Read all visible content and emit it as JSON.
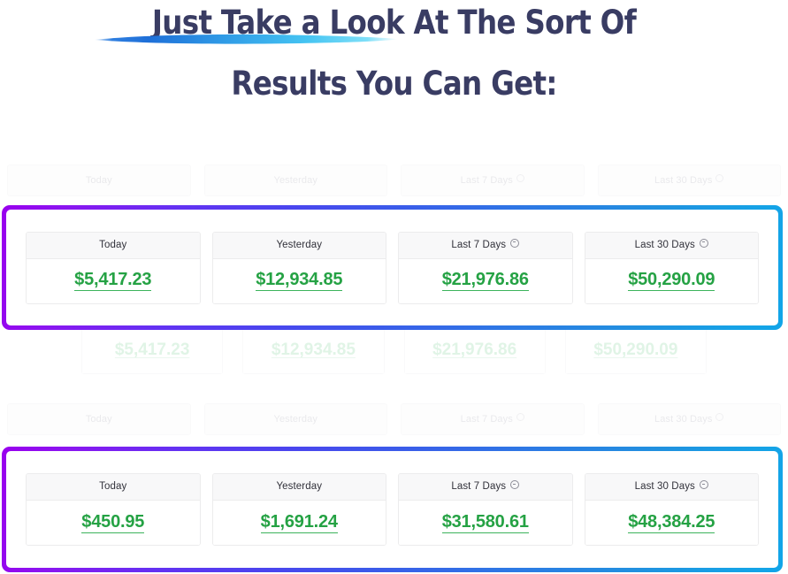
{
  "headline": {
    "line1": "Just Take a Look At The Sort Of",
    "line2": "Results You Can Get:",
    "color": "#393c63",
    "swoosh_color_start": "#1c5fd0",
    "swoosh_color_end": "#49d2f5"
  },
  "theme": {
    "accent_gradient_start": "#9900ee",
    "accent_gradient_mid": "#3a5ce9",
    "accent_gradient_end": "#12a5e8",
    "value_green": "#25a244",
    "card_header_bg": "#f8f8f9",
    "card_border": "#ececed",
    "page_bg": "#ffffff"
  },
  "panels": [
    {
      "name": "earnings-panel-1",
      "cards": [
        {
          "label": "Today",
          "has_info_icon": false,
          "value": "$5,417.23"
        },
        {
          "label": "Yesterday",
          "has_info_icon": false,
          "value": "$12,934.85"
        },
        {
          "label": "Last 7 Days",
          "has_info_icon": true,
          "value": "$21,976.86"
        },
        {
          "label": "Last 30 Days",
          "has_info_icon": true,
          "value": "$50,290.09"
        }
      ]
    },
    {
      "name": "earnings-panel-2",
      "cards": [
        {
          "label": "Today",
          "has_info_icon": false,
          "value": "$450.95"
        },
        {
          "label": "Yesterday",
          "has_info_icon": false,
          "value": "$1,691.24"
        },
        {
          "label": "Last 7 Days",
          "has_info_icon": true,
          "value": "$31,580.61"
        },
        {
          "label": "Last 30 Days",
          "has_info_icon": true,
          "value": "$48,384.25"
        }
      ]
    }
  ],
  "background_ghost": {
    "top_header_row": [
      {
        "label": "Today",
        "has_info_icon": false
      },
      {
        "label": "Yesterday",
        "has_info_icon": false
      },
      {
        "label": "Last 7 Days",
        "has_info_icon": true
      },
      {
        "label": "Last 30 Days",
        "has_info_icon": true
      }
    ],
    "top_value_row": [
      "$5,417.23",
      "$12,934.85",
      "$21,976.86",
      "$50,290.09"
    ],
    "bottom_header_row": [
      {
        "label": "Today",
        "has_info_icon": false
      },
      {
        "label": "Yesterday",
        "has_info_icon": false
      },
      {
        "label": "Last 7 Days",
        "has_info_icon": true
      },
      {
        "label": "Last 30 Days",
        "has_info_icon": true
      }
    ]
  }
}
